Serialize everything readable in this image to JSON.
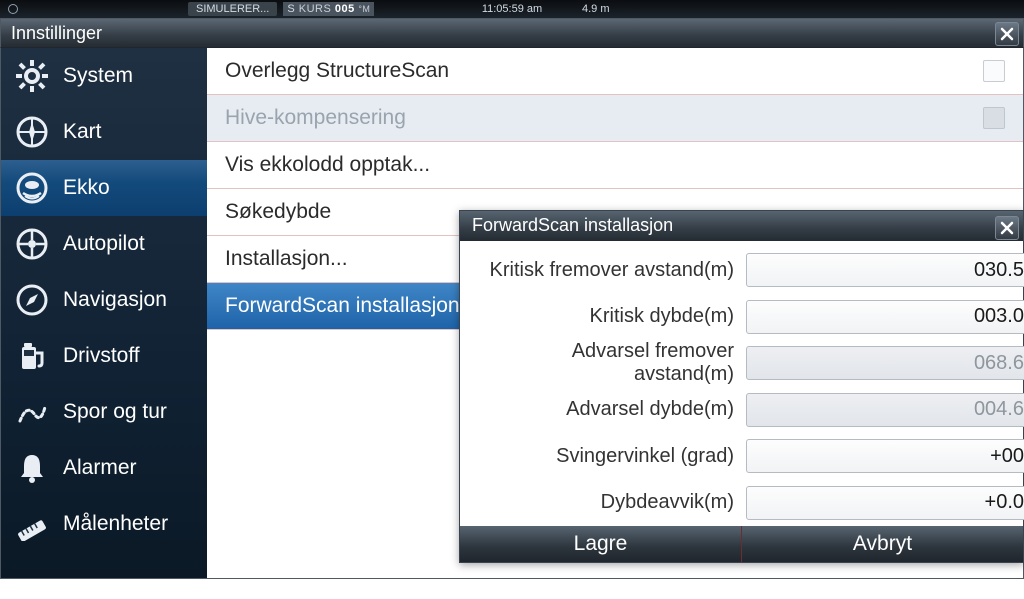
{
  "status": {
    "sim": "SIMULERER...",
    "kurs_label": "KURS",
    "kurs_value": "005",
    "kurs_unit": "°M",
    "kurs_prefix": "S",
    "time": "11:05:59 am",
    "depth": "4.9 m"
  },
  "settings_title": "Innstillinger",
  "sidebar": [
    {
      "id": "system",
      "label": "System"
    },
    {
      "id": "kart",
      "label": "Kart"
    },
    {
      "id": "ekko",
      "label": "Ekko"
    },
    {
      "id": "autopilot",
      "label": "Autopilot"
    },
    {
      "id": "navigasjon",
      "label": "Navigasjon"
    },
    {
      "id": "drivstoff",
      "label": "Drivstoff"
    },
    {
      "id": "spor",
      "label": "Spor og tur"
    },
    {
      "id": "alarmer",
      "label": "Alarmer"
    },
    {
      "id": "maalenheter",
      "label": "Målenheter"
    }
  ],
  "main": {
    "overlegg": "Overlegg StructureScan",
    "hive": "Hive-kompensering",
    "vis": "Vis ekkolodd opptak...",
    "sokedybde": "Søkedybde",
    "installasjon": "Installasjon...",
    "forwardscan": "ForwardScan installasjon..."
  },
  "modal": {
    "title": "ForwardScan installasjon",
    "fields": [
      {
        "label": "Kritisk fremover avstand(m)",
        "value": "030.5",
        "ro": false
      },
      {
        "label": "Kritisk dybde(m)",
        "value": "003.0",
        "ro": false
      },
      {
        "label": "Advarsel fremover avstand(m)",
        "value": "068.6",
        "ro": true
      },
      {
        "label": "Advarsel dybde(m)",
        "value": "004.6",
        "ro": true
      },
      {
        "label": "Svingervinkel (grad)",
        "value": "+00",
        "ro": false
      },
      {
        "label": "Dybdeavvik(m)",
        "value": "+0.0",
        "ro": false
      }
    ],
    "save": "Lagre",
    "cancel": "Avbryt"
  }
}
